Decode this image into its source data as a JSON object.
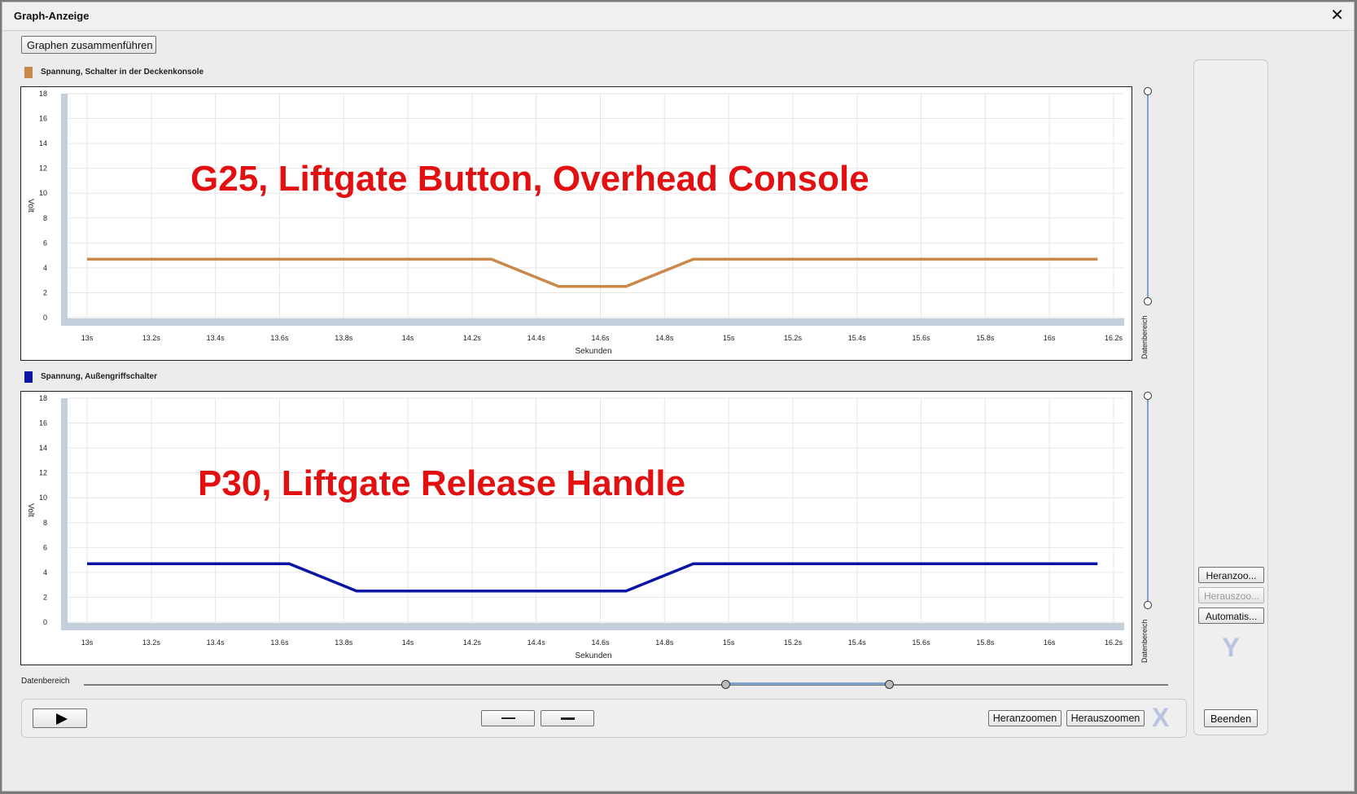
{
  "window": {
    "title": "Graph-Anzeige",
    "close_glyph": "✕"
  },
  "toolbar": {
    "merge_label": "Graphen zusammenführen"
  },
  "charts": [
    {
      "legend_label": "Spannung, Schalter in der Deckenkonsole",
      "color": "#c8894b",
      "annotation": "G25, Liftgate Button, Overhead Console",
      "annotation_color": "#e21010",
      "ylabel": "Volt",
      "xlabel": "Sekunden",
      "slider_label": "Datenbereich"
    },
    {
      "legend_label": "Spannung, Außengriffschalter",
      "color": "#0a15a5",
      "annotation": "P30, Liftgate Release Handle",
      "annotation_color": "#e21010",
      "ylabel": "Volt",
      "xlabel": "Sekunden",
      "slider_label": "Datenbereich"
    }
  ],
  "chart_data": [
    {
      "type": "line",
      "title": "",
      "xlabel": "Sekunden",
      "ylabel": "Volt",
      "xlim": [
        13,
        16.2
      ],
      "ylim": [
        0,
        18
      ],
      "y_ticks": [
        0,
        2,
        4,
        6,
        8,
        10,
        12,
        14,
        16,
        18
      ],
      "x_ticks": [
        13,
        13.2,
        13.4,
        13.6,
        13.8,
        14,
        14.2,
        14.4,
        14.6,
        14.8,
        15,
        15.2,
        15.4,
        15.6,
        15.8,
        16,
        16.2
      ],
      "x_tick_labels": [
        "13s",
        "13.2s",
        "13.4s",
        "13.6s",
        "13.8s",
        "14s",
        "14.2s",
        "14.4s",
        "14.6s",
        "14.8s",
        "15s",
        "15.2s",
        "15.4s",
        "15.6s",
        "15.8s",
        "16s",
        "16.2s"
      ],
      "grid": true,
      "legend": "top-left",
      "series": [
        {
          "name": "Spannung, Schalter in der Deckenkonsole",
          "color": "#c8894b",
          "x": [
            13.0,
            14.26,
            14.47,
            14.68,
            14.89,
            16.15
          ],
          "y": [
            4.7,
            4.7,
            2.5,
            2.5,
            4.7,
            4.7
          ]
        }
      ]
    },
    {
      "type": "line",
      "title": "",
      "xlabel": "Sekunden",
      "ylabel": "Volt",
      "xlim": [
        13,
        16.2
      ],
      "ylim": [
        0,
        18
      ],
      "y_ticks": [
        0,
        2,
        4,
        6,
        8,
        10,
        12,
        14,
        16,
        18
      ],
      "x_ticks": [
        13,
        13.2,
        13.4,
        13.6,
        13.8,
        14,
        14.2,
        14.4,
        14.6,
        14.8,
        15,
        15.2,
        15.4,
        15.6,
        15.8,
        16,
        16.2
      ],
      "x_tick_labels": [
        "13s",
        "13.2s",
        "13.4s",
        "13.6s",
        "13.8s",
        "14s",
        "14.2s",
        "14.4s",
        "14.6s",
        "14.8s",
        "15s",
        "15.2s",
        "15.4s",
        "15.6s",
        "15.8s",
        "16s",
        "16.2s"
      ],
      "grid": true,
      "legend": "top-left",
      "series": [
        {
          "name": "Spannung, Außengriffschalter",
          "color": "#0a15a5",
          "x": [
            13.0,
            13.63,
            13.84,
            14.68,
            14.89,
            16.15
          ],
          "y": [
            4.7,
            4.7,
            2.5,
            2.5,
            4.7,
            4.7
          ]
        }
      ]
    }
  ],
  "right_panel": {
    "zoom_in": "Heranzoo...",
    "zoom_out": "Herauszoo...",
    "auto": "Automatis...",
    "axis_letter": "Y"
  },
  "bottom": {
    "range_label": "Datenbereich",
    "zoom_in": "Heranzoomen",
    "zoom_out": "Herauszoomen",
    "axis_letter": "X",
    "exit": "Beenden"
  },
  "icons": {
    "play": "play-icon",
    "step_back": "minus-icon",
    "step_forward": "minus-icon",
    "close": "close-icon"
  }
}
